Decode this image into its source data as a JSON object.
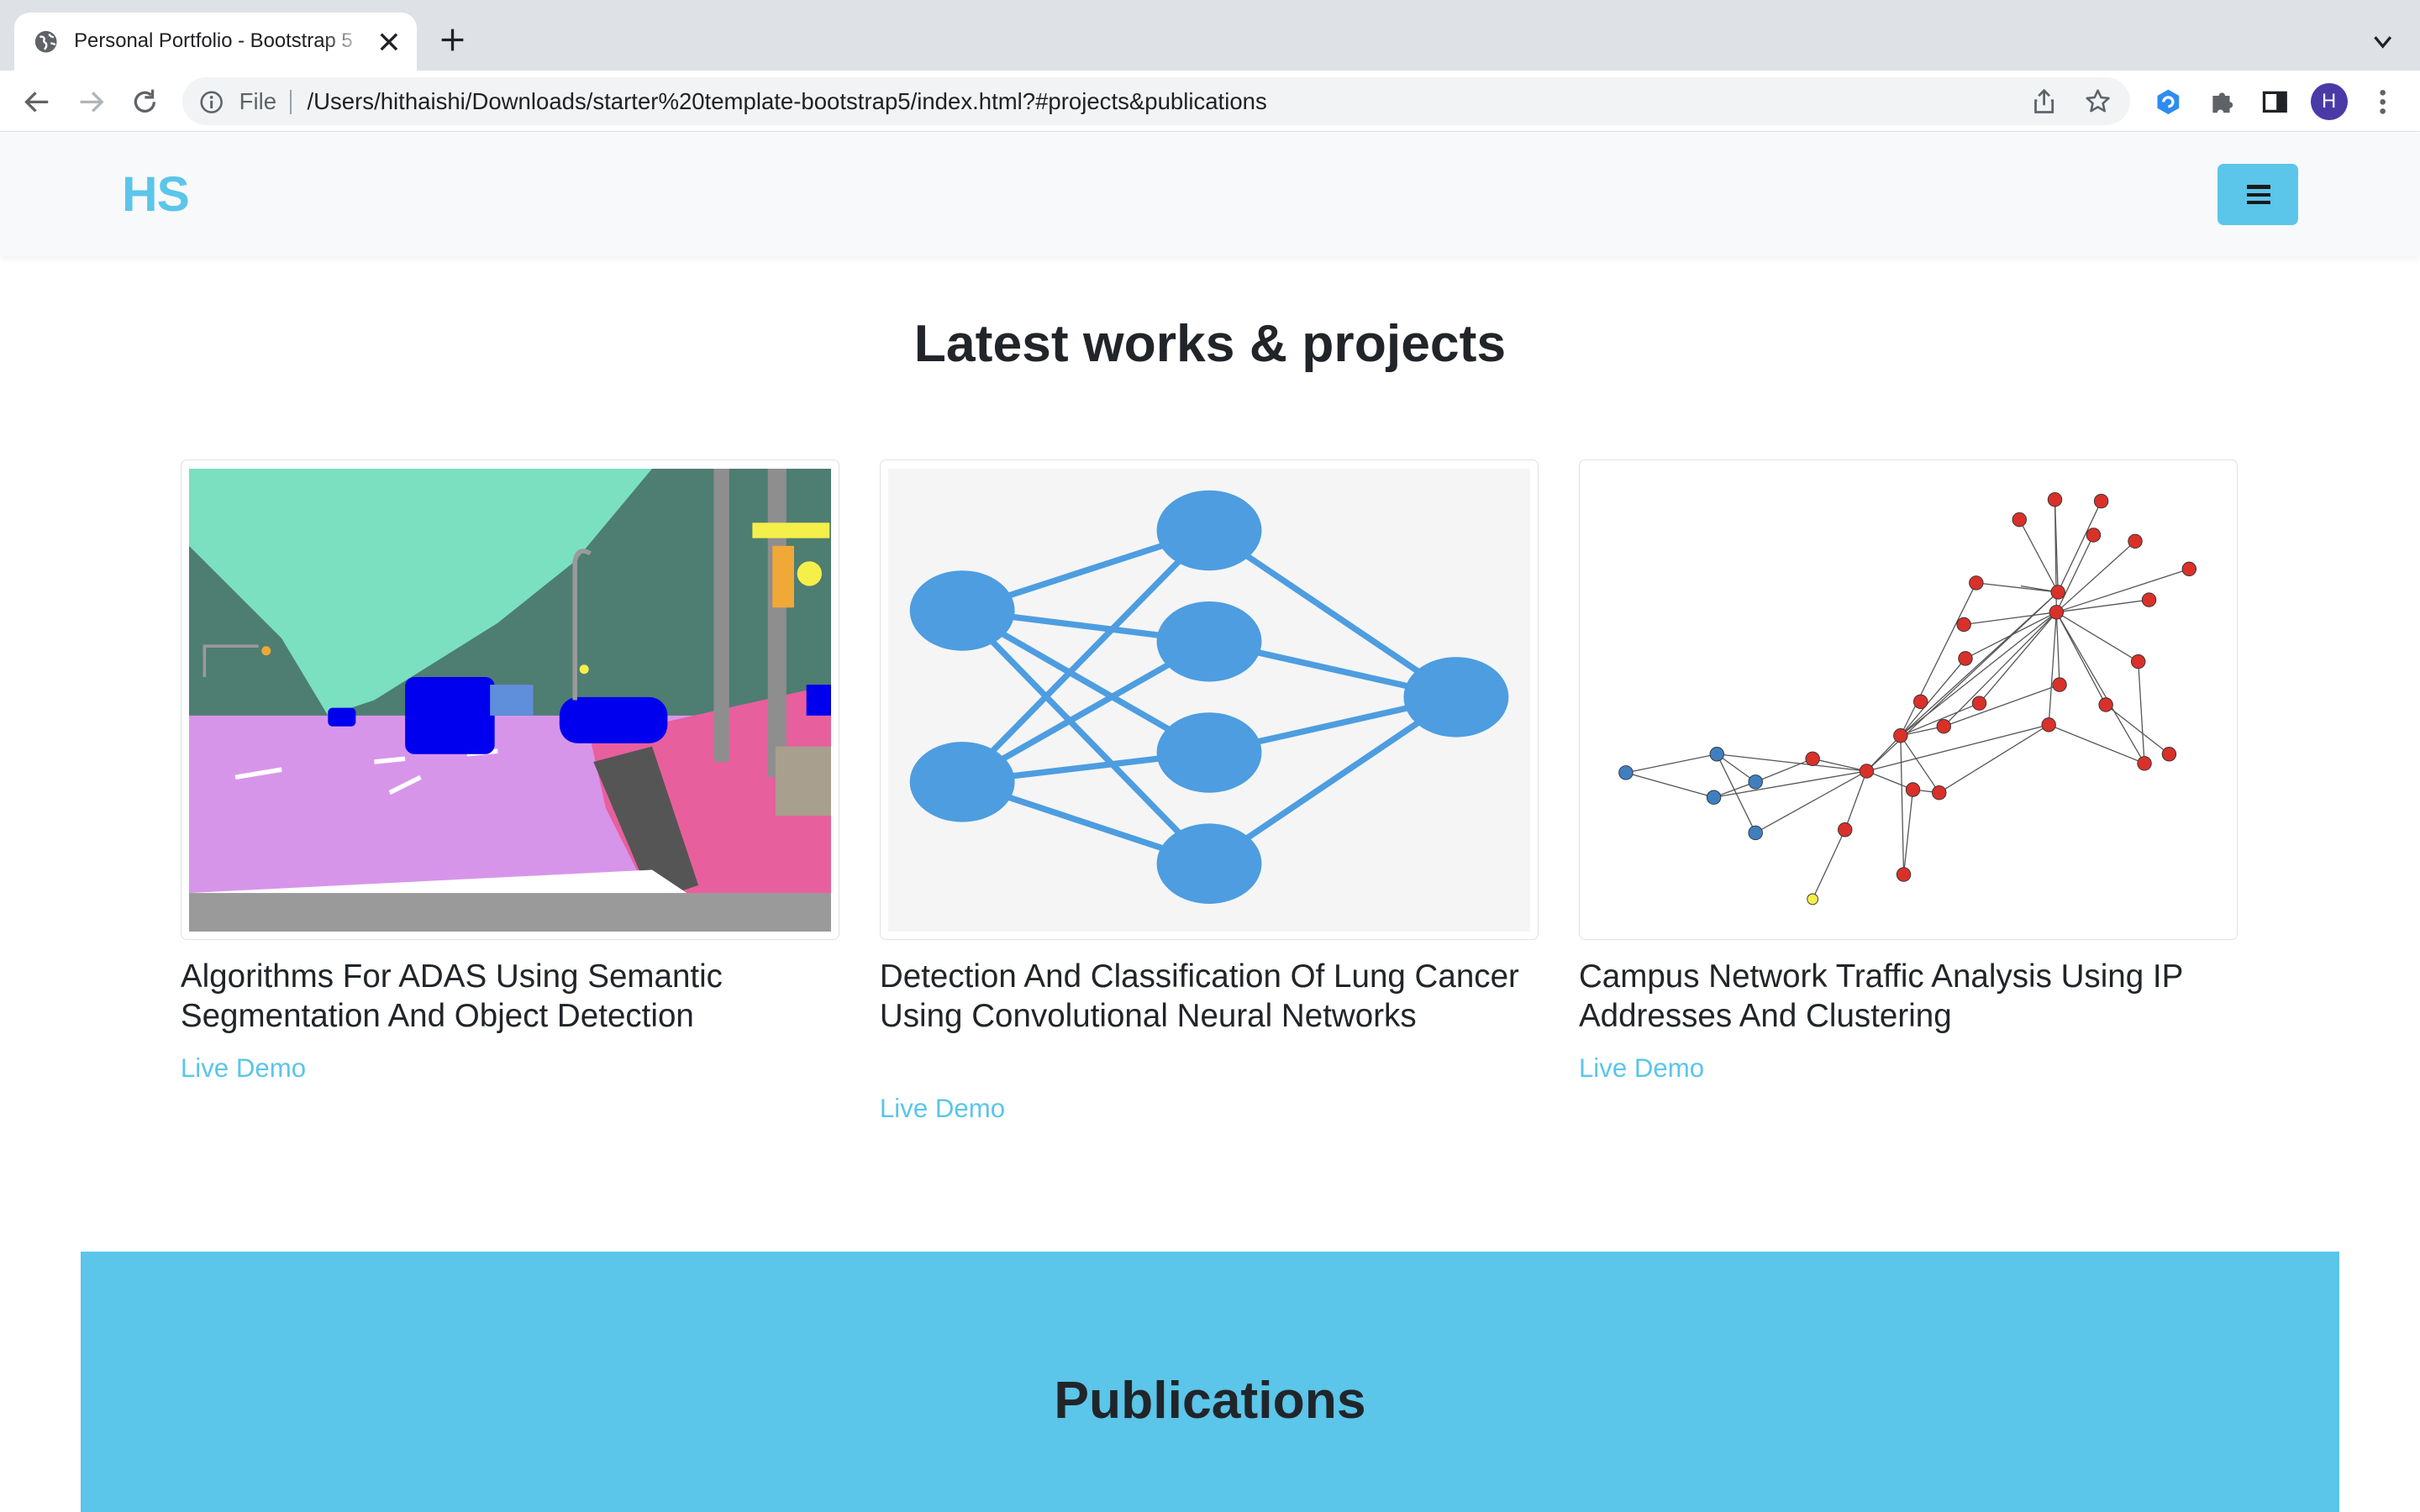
{
  "browser": {
    "tab_title": "Personal Portfolio - Bootstrap 5",
    "url_scheme": "File",
    "url": "/Users/hithaishi/Downloads/starter%20template-bootstrap5/index.html?#projects&publications",
    "avatar_letter": "H"
  },
  "navbar": {
    "brand": "HS"
  },
  "projects": {
    "title": "Latest works & projects",
    "cards": [
      {
        "title": "Algorithms For ADAS Using Semantic Segmentation And Object Detection",
        "link": "Live Demo",
        "image": "semantic-segmentation-street-scene"
      },
      {
        "title": "Detection And Classification Of Lung Cancer Using Convolutional Neural Networks",
        "link": "Live Demo",
        "image": "neural-network-diagram"
      },
      {
        "title": "Campus Network Traffic Analysis Using IP Addresses And Clustering",
        "link": "Live Demo",
        "image": "network-graph-clusters"
      }
    ]
  },
  "publications": {
    "title": "Publications"
  },
  "colors": {
    "accent": "#5bc5ea",
    "navbar_bg": "#f8f9fa",
    "heading": "#212529"
  }
}
